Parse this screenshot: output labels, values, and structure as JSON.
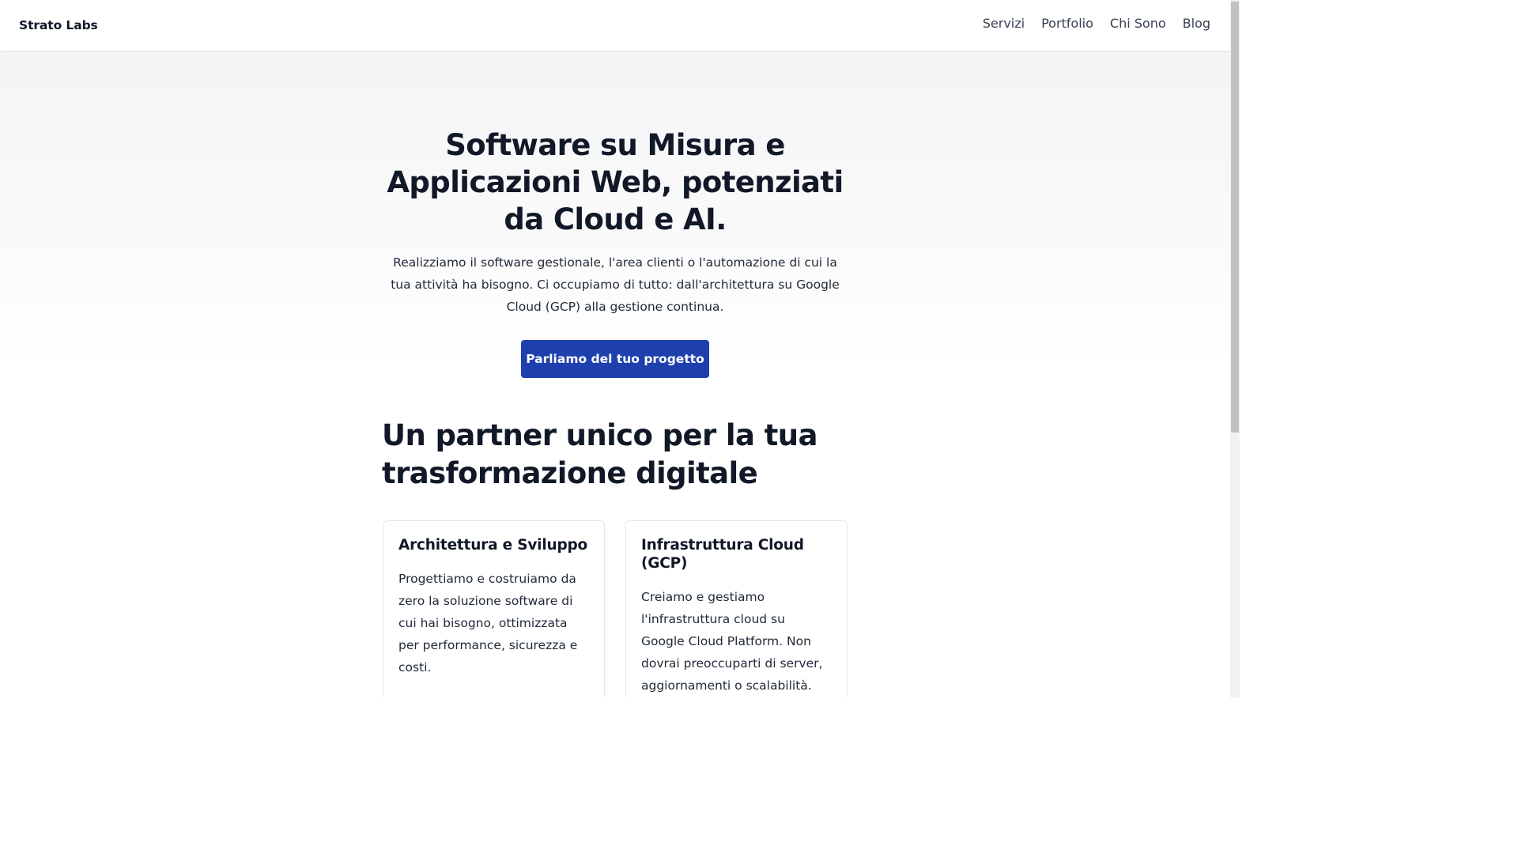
{
  "header": {
    "brand": "Strato Labs",
    "nav": [
      {
        "label": "Servizi"
      },
      {
        "label": "Portfolio"
      },
      {
        "label": "Chi Sono"
      },
      {
        "label": "Blog"
      }
    ]
  },
  "hero": {
    "title": "Software su Misura e Applicazioni Web, potenziati da Cloud e AI.",
    "description": "Realizziamo il software gestionale, l'area clienti o l'automazione di cui la tua attività ha bisogno. Ci occupiamo di tutto: dall'architettura su Google Cloud (GCP) alla gestione continua.",
    "cta_label": "Parliamo del tuo progetto"
  },
  "section": {
    "title": "Un partner unico per la tua trasformazione digitale",
    "cards": [
      {
        "title": "Architettura e Sviluppo",
        "text": "Progettiamo e costruiamo da zero la soluzione software di cui hai bisogno, ottimizzata per performance, sicurezza e costi."
      },
      {
        "title": "Infrastruttura Cloud (GCP)",
        "text": "Creiamo e gestiamo l'infrastruttura cloud su Google Cloud Platform. Non dovrai preoccuparti di server, aggiornamenti o scalabilità."
      }
    ]
  },
  "colors": {
    "accent": "#1e40af",
    "text": "#111827",
    "card_border": "#e5e7eb"
  }
}
